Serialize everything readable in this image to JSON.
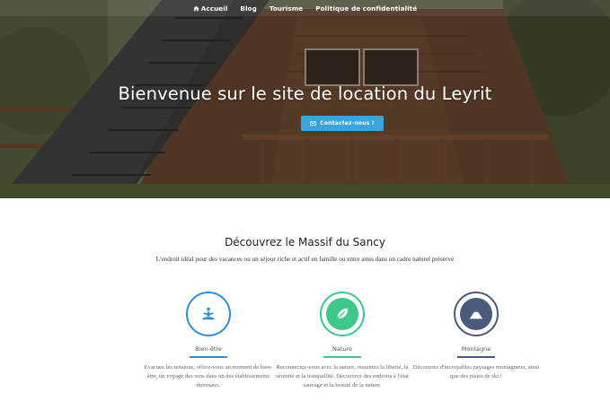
{
  "nav": {
    "items": [
      {
        "label": "Accueil",
        "icon": "home-icon"
      },
      {
        "label": "Blog"
      },
      {
        "label": "Tourisme"
      },
      {
        "label": "Politique de confidentialité"
      }
    ]
  },
  "hero": {
    "title": "Bienvenue sur le site de location du Leyrit",
    "button_label": "Contactez-nous !",
    "button_icon": "envelope-icon",
    "button_color": "#3ba4dc"
  },
  "section": {
    "title": "Découvrez le Massif du Sancy",
    "subtitle": "L'endroit idéal pour des vacances ou un séjour riche et actif en famille ou entre amis dans un cadre naturel préservé"
  },
  "features": [
    {
      "label": "Bien-être",
      "icon": "meditation-icon",
      "color": "#2f8fd4",
      "desc": "Evacuez les tensions, offrez-vous un moment de bien-être, un voyage des sens dans un des établissements thermaux."
    },
    {
      "label": "Nature",
      "icon": "leaf-icon",
      "color": "#3cc98a",
      "desc": "Reconnectez-vous avec la nature, ressentez la liberté, la sérénité et la tranquillité. Découvrez des endroits à l'état sauvage et la beauté de la nature."
    },
    {
      "label": "Montagne",
      "icon": "mountain-icon",
      "color": "#4a5a7a",
      "desc": "Découvrez d'incroyables paysages montagneux, ainsi que des pistes de ski !"
    }
  ]
}
